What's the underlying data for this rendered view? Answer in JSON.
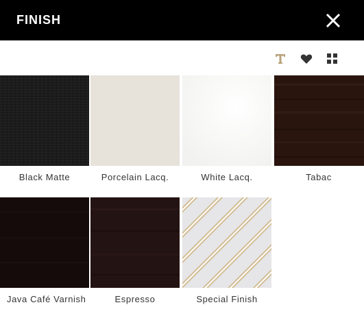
{
  "header": {
    "title": "FINISH"
  },
  "icons": {
    "close": "close-icon",
    "text": "text-icon",
    "favorite": "heart-icon",
    "grid": "grid-icon"
  },
  "colors": {
    "header_bg": "#000000",
    "accent": "#b8a27a",
    "icon_dark": "#333333"
  },
  "finishes": [
    {
      "label": "Black Matte",
      "color": "#1c1c1c"
    },
    {
      "label": "Porcelain Lacq.",
      "color": "#e7e2da"
    },
    {
      "label": "White Lacq.",
      "color": "#f7f7f5"
    },
    {
      "label": "Tabac",
      "color": "#2a150e"
    },
    {
      "label": "Java Café Varnish",
      "color": "#150b0b"
    },
    {
      "label": "Espresso",
      "color": "#241313"
    },
    {
      "label": "Special Finish",
      "color": "#e6e6e8"
    }
  ]
}
